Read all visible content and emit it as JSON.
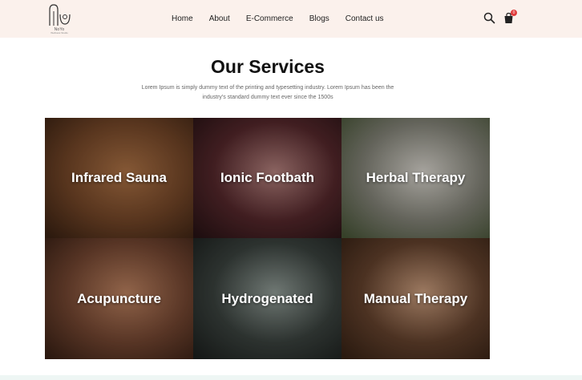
{
  "brand": {
    "name": "NoYo",
    "tagline": "Wellness Studio"
  },
  "nav": {
    "items": [
      "Home",
      "About",
      "E-Commerce",
      "Blogs",
      "Contact us"
    ]
  },
  "header_icons": {
    "search": "search-icon",
    "cart": "shopping-bag-icon",
    "cart_count": "0"
  },
  "services": {
    "title": "Our Services",
    "description": "Lorem Ipsum is simply dummy text of the printing and typesetting industry. Lorem Ipsum has been the industry's standard dummy text ever since the 1500s",
    "cards": [
      {
        "label": "Infrared Sauna",
        "colors": [
          "#7a4a2a",
          "#b87a4a",
          "#3e2414"
        ]
      },
      {
        "label": "Ionic Footbath",
        "colors": [
          "#5a2a2e",
          "#c08a86",
          "#2a1416"
        ]
      },
      {
        "label": "Herbal Therapy",
        "colors": [
          "#8a8a7e",
          "#e6e2da",
          "#4c5a3a"
        ]
      },
      {
        "label": "Acupuncture",
        "colors": [
          "#7a4a34",
          "#c88a66",
          "#3c2216"
        ]
      },
      {
        "label": "Hydrogenated",
        "colors": [
          "#3e4642",
          "#9aa6a0",
          "#1e2220"
        ]
      },
      {
        "label": "Manual Therapy",
        "colors": [
          "#6a4630",
          "#d8a886",
          "#3a2416"
        ]
      }
    ]
  }
}
